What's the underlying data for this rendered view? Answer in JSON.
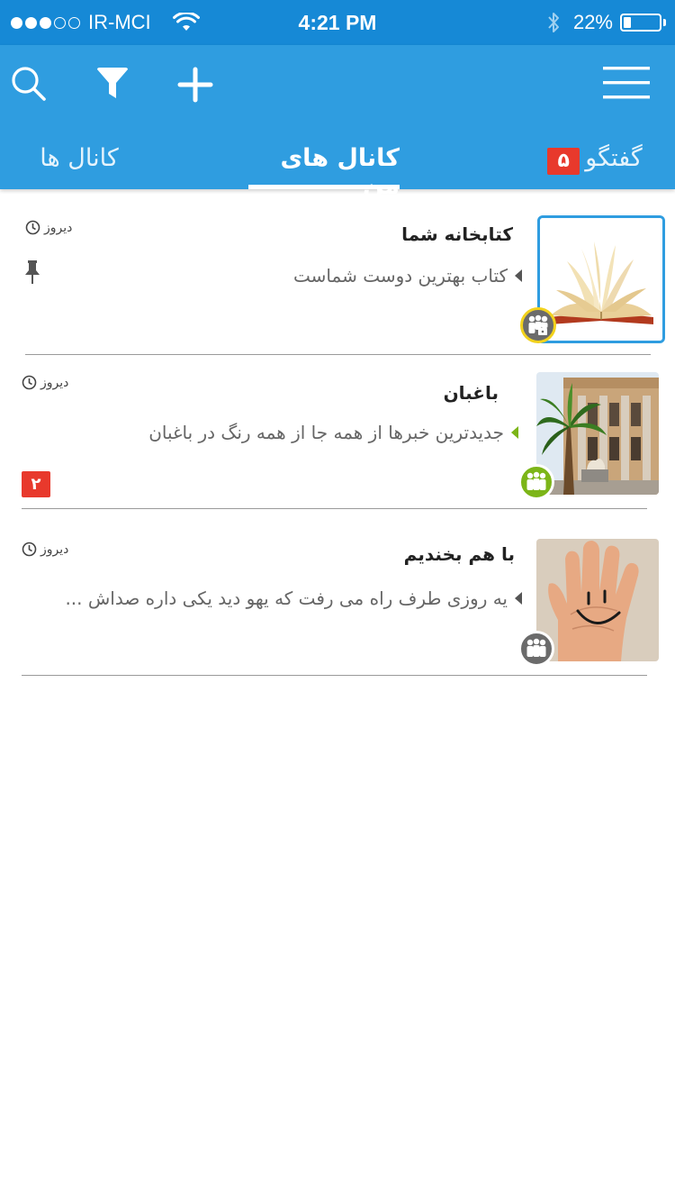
{
  "status_bar": {
    "carrier": "IR-MCI",
    "signal_filled": 3,
    "signal_total": 5,
    "time": "4:21 PM",
    "battery_percent": "22%",
    "battery_level": 0.22
  },
  "header": {
    "icons": [
      "search-icon",
      "filter-icon",
      "add-icon",
      "menu-icon"
    ],
    "tabs": [
      {
        "label": "کانال ها",
        "active": false
      },
      {
        "label": "کانال های من",
        "active": true
      },
      {
        "label": "گفتگو",
        "active": false,
        "badge": "۵"
      }
    ]
  },
  "channels": [
    {
      "title": "کتابخانه شما",
      "preview": "کتاب بهترین دوست شماست",
      "time": "دیروز",
      "pinned": true,
      "unread": "",
      "thumbnail": "open-book",
      "badge_icon": "private-group-icon"
    },
    {
      "title": "باغبان",
      "preview": "جدیدترین خبرها از همه جا از همه رنگ در باغبان",
      "time": "دیروز",
      "pinned": false,
      "unread": "۲",
      "thumbnail": "building-with-palm",
      "badge_icon": "group-icon"
    },
    {
      "title": "با هم بخندیم",
      "preview": "یه روزی طرف راه می رفت که یهو دید یکی داره صداش ...",
      "time": "دیروز",
      "pinned": false,
      "unread": "",
      "thumbnail": "smiley-hand",
      "badge_icon": "group-icon"
    }
  ],
  "colors": {
    "status_bar": "#1689d6",
    "header": "#2f9de0",
    "badge_red": "#e8392c",
    "active_green": "#7cb518",
    "group_gray": "#6b6b6b"
  }
}
